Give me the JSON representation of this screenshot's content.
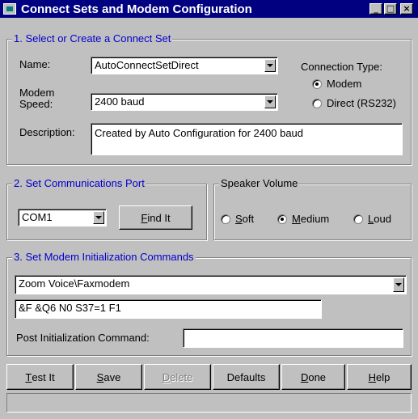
{
  "window": {
    "title": "Connect Sets and Modem Configuration"
  },
  "titlebar_buttons": {
    "minimize": "_",
    "maximize": "□",
    "close": "×"
  },
  "section1": {
    "legend": "1. Select or Create a Connect Set",
    "name_label": "Name:",
    "name_value": "AutoConnectSetDirect",
    "modem_speed_label_line1": "Modem",
    "modem_speed_label_line2": "Speed:",
    "modem_speed_value": "2400 baud",
    "description_label": "Description:",
    "description_value": "Created by Auto Configuration for 2400 baud",
    "connection_type": {
      "label": "Connection Type:",
      "options": [
        {
          "label": "Modem",
          "checked": true
        },
        {
          "label": "Direct (RS232)",
          "checked": false
        }
      ]
    }
  },
  "section2": {
    "legend": "2. Set Communications Port",
    "port_value": "COM1",
    "find_button": {
      "mnemonic": "F",
      "rest": "ind It"
    }
  },
  "speaker": {
    "legend": "Speaker Volume",
    "options": [
      {
        "mnemonic": "S",
        "rest": "oft",
        "checked": false
      },
      {
        "mnemonic": "M",
        "rest": "edium",
        "checked": true
      },
      {
        "mnemonic": "L",
        "rest": "oud",
        "checked": false
      }
    ]
  },
  "section3": {
    "legend": "3. Set Modem Initialization Commands",
    "modem_value": "Zoom Voice\\Faxmodem",
    "init_string": "&F &Q6 N0 S37=1 F1",
    "post_init_label": "Post Initialization Command:",
    "post_init_value": ""
  },
  "buttons": {
    "test": {
      "mnemonic": "T",
      "rest": "est It"
    },
    "save": {
      "mnemonic": "S",
      "rest": "ave"
    },
    "delete": {
      "mnemonic": "D",
      "rest": "elete"
    },
    "defaults": {
      "label": "Defaults"
    },
    "done": {
      "mnemonic": "D",
      "rest": "one"
    },
    "help": {
      "mnemonic": "H",
      "rest": "elp"
    }
  },
  "statusbar": {
    "text": ""
  },
  "colors": {
    "titlebar": "#000080",
    "face": "#c0c0c0",
    "legend": "#0000cc"
  }
}
